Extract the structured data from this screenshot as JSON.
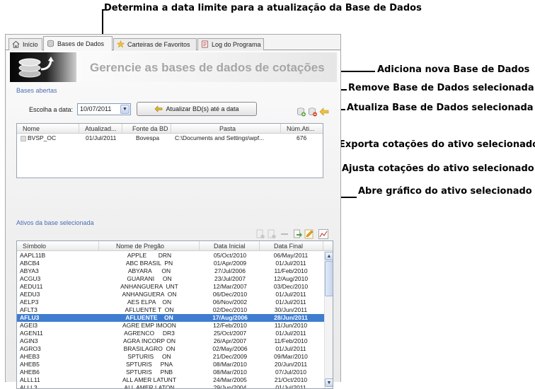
{
  "callouts": {
    "data_limite": "Determina a data limite para a atualização  da Base de Dados",
    "adiciona": "Adiciona nova Base de Dados",
    "remove": "Remove Base de Dados selecionada",
    "atualiza": "Atualiza Base de Dados selecionada",
    "exporta": "Exporta cotações do ativo selecionado",
    "ajusta": "Ajusta cotações do ativo selecionado",
    "grafico": "Abre gráfico do ativo selecionado"
  },
  "tabs": [
    {
      "label": "Início",
      "icon": "home-icon"
    },
    {
      "label": "Bases de Dados",
      "icon": "database-icon"
    },
    {
      "label": "Carteiras de Favoritos",
      "icon": "star-icon"
    },
    {
      "label": "Log do Programa",
      "icon": "log-icon"
    }
  ],
  "header": {
    "title": "Gerencie as bases de dados de cotações"
  },
  "bases": {
    "section_label": "Bases abertas",
    "date_label": "Escolha a data:",
    "date_value": "10/07/2011",
    "update_button": "Atualizar BD(s) até a data",
    "columns": [
      "Nome",
      "Atualizad...",
      "Fonte da BD",
      "Pasta",
      "Núm.Ati..."
    ],
    "rows": [
      [
        "BVSP_OC",
        "01/Jul/2011",
        "Bovespa",
        "C:\\Documents and Settings\\wpf...",
        "676"
      ]
    ]
  },
  "ativos": {
    "section_label": "Ativos da base selecionada",
    "columns": [
      "Símbolo",
      "Nome de Pregão",
      "Data Inicial",
      "Data Final"
    ],
    "selected_index": 8,
    "rows": [
      [
        "AAPL11B",
        "APPLE       DRN",
        "05/Oct/2010",
        "06/May/2011"
      ],
      [
        "ABCB4",
        "ABC BRASIL  PN",
        "01/Apr/2009",
        "01/Jul/2011"
      ],
      [
        "ABYA3",
        "ABYARA      ON",
        "27/Jul/2006",
        "11/Feb/2010"
      ],
      [
        "ACGU3",
        "GUARANI     ON",
        "23/Jul/2007",
        "12/Aug/2010"
      ],
      [
        "AEDU11",
        "ANHANGUERA  UNT",
        "12/Mar/2007",
        "03/Dec/2010"
      ],
      [
        "AEDU3",
        "ANHANGUERA  ON",
        "06/Dec/2010",
        "01/Jul/2011"
      ],
      [
        "AELP3",
        "AES ELPA    ON",
        "06/Nov/2002",
        "01/Jul/2011"
      ],
      [
        "AFLT3",
        "AFLUENTE T  ON",
        "02/Dec/2010",
        "30/Jun/2011"
      ],
      [
        "AFLU3",
        "AFLUENTE    ON",
        "17/Aug/2006",
        "28/Jun/2011"
      ],
      [
        "AGEI3",
        "AGRE EMP IMOON",
        "12/Feb/2010",
        "11/Jun/2010"
      ],
      [
        "AGEN11",
        "AGRENCO     DR3",
        "25/Oct/2007",
        "01/Jul/2011"
      ],
      [
        "AGIN3",
        "AGRA INCORP ON",
        "26/Apr/2007",
        "11/Feb/2010"
      ],
      [
        "AGRO3",
        "BRASILAGRO  ON",
        "02/May/2006",
        "01/Jul/2011"
      ],
      [
        "AHEB3",
        "SPTURIS     ON",
        "21/Dec/2009",
        "09/Mar/2010"
      ],
      [
        "AHEB5",
        "SPTURIS     PNA",
        "08/Mar/2010",
        "20/Jun/2011"
      ],
      [
        "AHEB6",
        "SPTURIS     PNB",
        "08/Mar/2010",
        "07/Jul/2010"
      ],
      [
        "ALLL11",
        "ALL AMER LATUNT",
        "24/Mar/2005",
        "21/Oct/2010"
      ],
      [
        "ALLL3",
        "ALL AMER LATON",
        "29/Jun/2004",
        "01/Jul/2011"
      ]
    ]
  },
  "colors": {
    "selection": "#3f7dd0",
    "section_label": "#4a6fb5",
    "title": "#a6a6a6"
  }
}
